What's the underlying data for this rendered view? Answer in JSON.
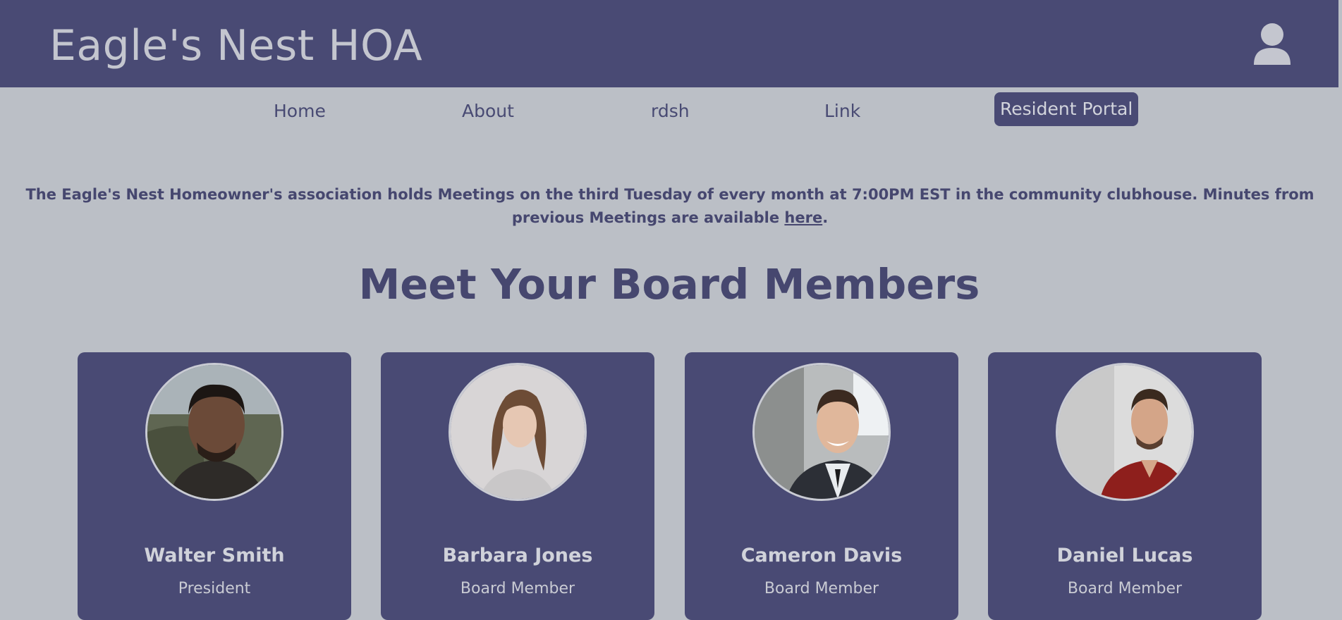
{
  "header": {
    "site_title": "Eagle's Nest HOA",
    "account_icon": "user-account-icon"
  },
  "nav": {
    "items": [
      {
        "label": "Home"
      },
      {
        "label": "About"
      },
      {
        "label": "rdsh"
      },
      {
        "label": "Link"
      },
      {
        "label": "Resident Portal"
      }
    ]
  },
  "notice": {
    "text_before": "The Eagle's Nest Homeowner's association holds Meetings on the third Tuesday of every month at 7:00PM EST in the community clubhouse. Minutes from previous Meetings are available ",
    "link_label": "here",
    "text_after": "."
  },
  "board": {
    "title": "Meet Your Board Members",
    "members": [
      {
        "name": "Walter Smith",
        "role": "President"
      },
      {
        "name": "Barbara Jones",
        "role": "Board Member"
      },
      {
        "name": "Cameron Davis",
        "role": "Board Member"
      },
      {
        "name": "Daniel Lucas",
        "role": "Board Member"
      }
    ]
  },
  "colors": {
    "brand": "#494a74",
    "background": "#bbbfc6",
    "header_text": "#c4c6cf",
    "heading_text": "#46476f"
  }
}
